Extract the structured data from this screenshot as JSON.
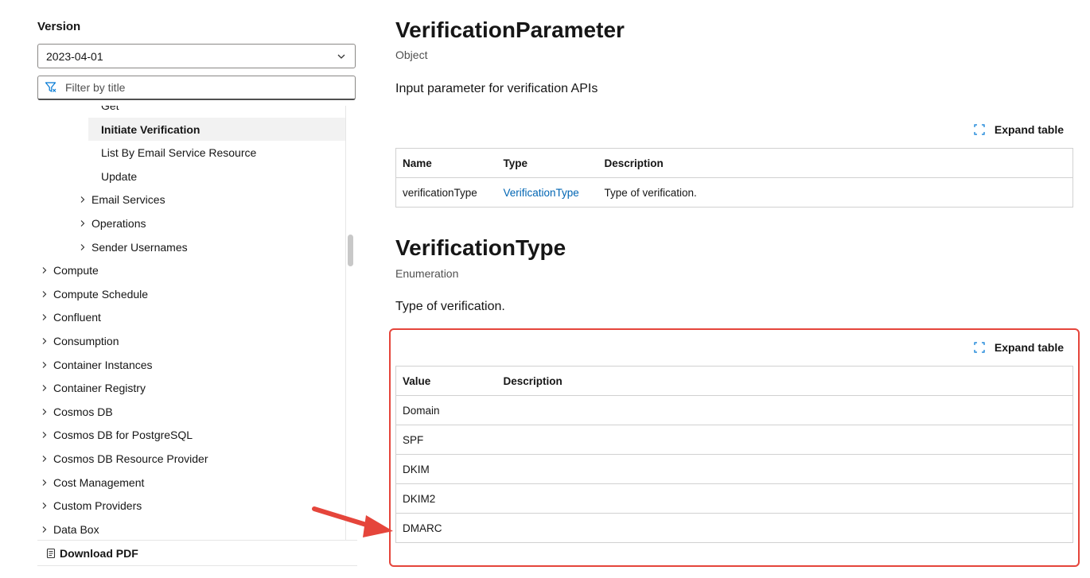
{
  "sidebar": {
    "version_label": "Version",
    "version_value": "2023-04-01",
    "filter_placeholder": "Filter by title",
    "tree": [
      {
        "label": "Get",
        "level": 3,
        "expandable": false,
        "active": false
      },
      {
        "label": "Initiate Verification",
        "level": 3,
        "expandable": false,
        "active": true
      },
      {
        "label": "List By Email Service Resource",
        "level": 3,
        "expandable": false,
        "active": false
      },
      {
        "label": "Update",
        "level": 3,
        "expandable": false,
        "active": false
      },
      {
        "label": "Email Services",
        "level": 2,
        "expandable": true,
        "active": false
      },
      {
        "label": "Operations",
        "level": 2,
        "expandable": true,
        "active": false
      },
      {
        "label": "Sender Usernames",
        "level": 2,
        "expandable": true,
        "active": false
      },
      {
        "label": "Compute",
        "level": 1,
        "expandable": true,
        "active": false
      },
      {
        "label": "Compute Schedule",
        "level": 1,
        "expandable": true,
        "active": false
      },
      {
        "label": "Confluent",
        "level": 1,
        "expandable": true,
        "active": false
      },
      {
        "label": "Consumption",
        "level": 1,
        "expandable": true,
        "active": false
      },
      {
        "label": "Container Instances",
        "level": 1,
        "expandable": true,
        "active": false
      },
      {
        "label": "Container Registry",
        "level": 1,
        "expandable": true,
        "active": false
      },
      {
        "label": "Cosmos DB",
        "level": 1,
        "expandable": true,
        "active": false
      },
      {
        "label": "Cosmos DB for PostgreSQL",
        "level": 1,
        "expandable": true,
        "active": false
      },
      {
        "label": "Cosmos DB Resource Provider",
        "level": 1,
        "expandable": true,
        "active": false
      },
      {
        "label": "Cost Management",
        "level": 1,
        "expandable": true,
        "active": false
      },
      {
        "label": "Custom Providers",
        "level": 1,
        "expandable": true,
        "active": false
      },
      {
        "label": "Data Box",
        "level": 1,
        "expandable": true,
        "active": false
      }
    ],
    "download_label": "Download PDF"
  },
  "section1": {
    "title": "VerificationParameter",
    "kind": "Object",
    "description": "Input parameter for verification APIs",
    "expand_label": "Expand table",
    "headers": [
      "Name",
      "Type",
      "Description"
    ],
    "rows": [
      {
        "name": "verificationType",
        "type": "VerificationType",
        "description": "Type of verification."
      }
    ]
  },
  "section2": {
    "title": "VerificationType",
    "kind": "Enumeration",
    "description": "Type of verification.",
    "expand_label": "Expand table",
    "headers": [
      "Value",
      "Description"
    ],
    "rows": [
      {
        "value": "Domain",
        "description": ""
      },
      {
        "value": "SPF",
        "description": ""
      },
      {
        "value": "DKIM",
        "description": ""
      },
      {
        "value": "DKIM2",
        "description": ""
      },
      {
        "value": "DMARC",
        "description": ""
      }
    ]
  },
  "colors": {
    "accent_link": "#0065b3",
    "annotation": "#e5453b"
  },
  "icons": {
    "filter": "filter-icon",
    "chevron": "chevron-down-icon",
    "expand": "expand-icon",
    "pdf": "document-icon"
  }
}
